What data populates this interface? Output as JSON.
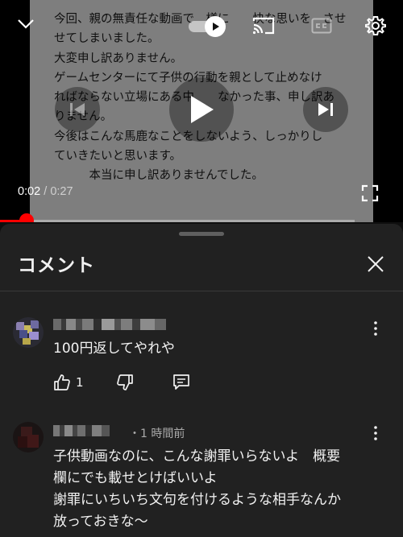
{
  "player": {
    "overlay_lines": [
      "今回、親の無責任な動画で　様に　　快な思いを　させ",
      "せてしまいました。",
      "大変申し訳ありません。",
      "ゲームセンターにて子供の行動を親として止めなけ",
      "ればならない立場にある中　　なかった事、申し訳あ",
      "りません。",
      "今後はこんな馬鹿なことをしないよう、しっかりし",
      "ていきたいと思います。",
      "　　　本当に申し訳ありませんでした。"
    ],
    "current_time": "0:02",
    "separator": " / ",
    "duration": "0:27",
    "progress": 0.074,
    "accent_color": "#ff0000"
  },
  "comments_panel": {
    "title": "コメント",
    "comments": [
      {
        "text_lines": [
          "100円返してやれや"
        ],
        "like_count": "1"
      },
      {
        "time": "・1 時間前",
        "text_lines": [
          "子供動画なのに、こんな謝罪いらないよ　概要",
          "欄にでも載せとけばいいよ",
          "謝罪にいちいち文句を付けるような相手なんか",
          "放っておきな〜"
        ]
      }
    ]
  },
  "icons": {
    "collapse": "chevron-down-icon",
    "autoplay": "autoplay-toggle-icon",
    "cast": "cast-icon",
    "captions": "captions-icon",
    "settings": "gear-icon",
    "previous": "skip-previous-icon",
    "play": "play-icon",
    "next": "skip-next-icon",
    "fullscreen": "fullscreen-icon",
    "close": "close-icon",
    "more": "more-vert-icon",
    "like": "thumb-up-icon",
    "dislike": "thumb-down-icon",
    "reply": "reply-icon"
  }
}
